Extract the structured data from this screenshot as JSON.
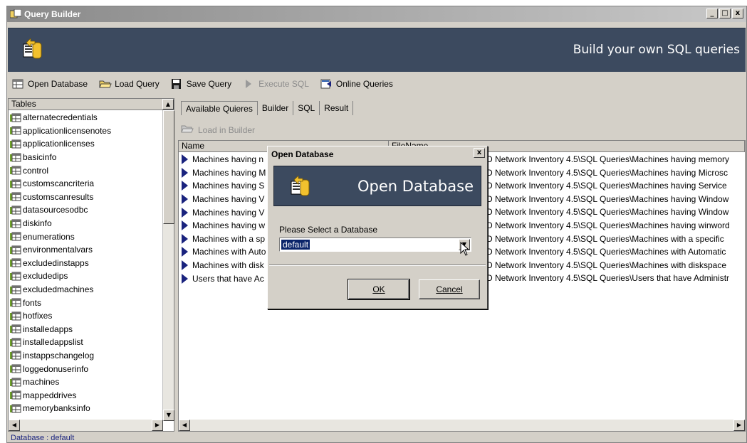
{
  "window": {
    "title": "Query Builder",
    "min": "_",
    "max": "□",
    "close": "x"
  },
  "banner": {
    "text": "Build your own SQL queries"
  },
  "toolbar": {
    "open_database": "Open Database",
    "load_query": "Load Query",
    "save_query": "Save Query",
    "execute_sql": "Execute SQL",
    "online_queries": "Online Queries"
  },
  "tables_panel": {
    "header": "Tables",
    "items": [
      "alternatecredentials",
      "applicationlicensenotes",
      "applicationlicenses",
      "basicinfo",
      "control",
      "customscancriteria",
      "customscanresults",
      "datasourcesodbc",
      "diskinfo",
      "enumerations",
      "environmentalvars",
      "excludedinstapps",
      "excludedips",
      "excludedmachines",
      "fonts",
      "hotfixes",
      "installedapps",
      "installedappslist",
      "instappschangelog",
      "loggedonuserinfo",
      "machines",
      "mappeddrives",
      "memorybanksinfo"
    ]
  },
  "tabs": [
    "Available Quieres",
    "Builder",
    "SQL",
    "Result"
  ],
  "load_in_builder": "Load in Builder",
  "queries": {
    "col_name": "Name",
    "col_filename": "FileName",
    "rows": [
      {
        "name": "Machines having n",
        "file": "D Network Inventory 4.5\\SQL Queries\\Machines having memory"
      },
      {
        "name": "Machines having M",
        "file": "D Network Inventory 4.5\\SQL Queries\\Machines having Microsc"
      },
      {
        "name": "Machines having S",
        "file": "D Network Inventory 4.5\\SQL Queries\\Machines having Service"
      },
      {
        "name": "Machines having V",
        "file": "D Network Inventory 4.5\\SQL Queries\\Machines having Window"
      },
      {
        "name": "Machines having V",
        "file": "D Network Inventory 4.5\\SQL Queries\\Machines having Window"
      },
      {
        "name": "Machines having w",
        "file": "D Network Inventory 4.5\\SQL Queries\\Machines having winword"
      },
      {
        "name": "Machines with a sp",
        "file": "D Network Inventory 4.5\\SQL Queries\\Machines with a specific"
      },
      {
        "name": "Machines with Auto",
        "file": "D Network Inventory 4.5\\SQL Queries\\Machines with Automatic"
      },
      {
        "name": "Machines with disk",
        "file": "D Network Inventory 4.5\\SQL Queries\\Machines with diskspace"
      },
      {
        "name": "Users that have Ac",
        "file": "D Network Inventory 4.5\\SQL Queries\\Users that have Administr"
      }
    ]
  },
  "status": {
    "text": "Database : default"
  },
  "dialog": {
    "title": "Open Database",
    "close": "x",
    "banner_text": "Open Database",
    "label": "Please Select a Database",
    "selected": "default",
    "ok": "OK",
    "cancel": "Cancel"
  }
}
